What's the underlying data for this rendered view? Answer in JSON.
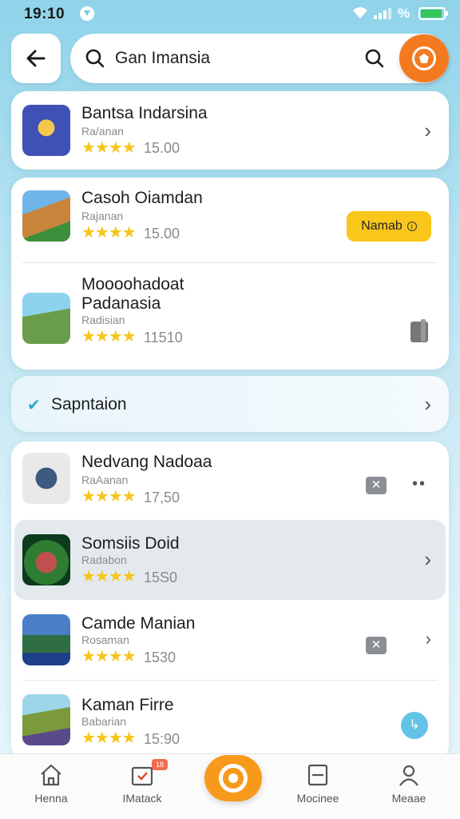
{
  "status_bar": {
    "time": "19:10",
    "battery_text": "%"
  },
  "search": {
    "query": "Gan Imansia"
  },
  "featured": {
    "title": "Bantsa Indarsina",
    "subtitle": "Ra/anan",
    "rating": 4,
    "count": "15.00",
    "stars_text": "★★★★"
  },
  "group_one": [
    {
      "title": "Casoh Oiamdan",
      "subtitle": "Rajanan",
      "stars_text": "★★★★",
      "count": "15.00",
      "action_label": "Namab"
    },
    {
      "title": "Moooohadoat",
      "title_line2": "Padanasia",
      "subtitle": "Radisian",
      "stars_text": "★★★★",
      "count": "11510"
    }
  ],
  "section": {
    "label": "Sapntaion"
  },
  "group_two": [
    {
      "title": "Nedvang Nadoaa",
      "subtitle": "RaAanan",
      "stars_text": "★★★★",
      "count": "17,50"
    },
    {
      "title": "Somsiis Doid",
      "subtitle": "Radabon",
      "stars_text": "★★★★",
      "count": "15S0"
    },
    {
      "title": "Camde Manian",
      "subtitle": "Rosaman",
      "stars_text": "★★★★",
      "count": "1530"
    },
    {
      "title": "Kaman Firre",
      "subtitle": "Babarian",
      "stars_text": "★★★★",
      "count": "15:90"
    }
  ],
  "bottom_nav": [
    {
      "label": "Henna",
      "icon": "home-icon"
    },
    {
      "label": "IMatack",
      "icon": "calendar-check-icon",
      "badge": "18"
    },
    {
      "label": "",
      "icon": "brand-center-icon"
    },
    {
      "label": "Mocinee",
      "icon": "square-minus-icon"
    },
    {
      "label": "Meaae",
      "icon": "person-icon"
    }
  ],
  "colors": {
    "accent_orange": "#f47a20",
    "star_yellow": "#f5c518",
    "badge_yellow": "#f9c61a",
    "teal": "#27a8c9"
  }
}
